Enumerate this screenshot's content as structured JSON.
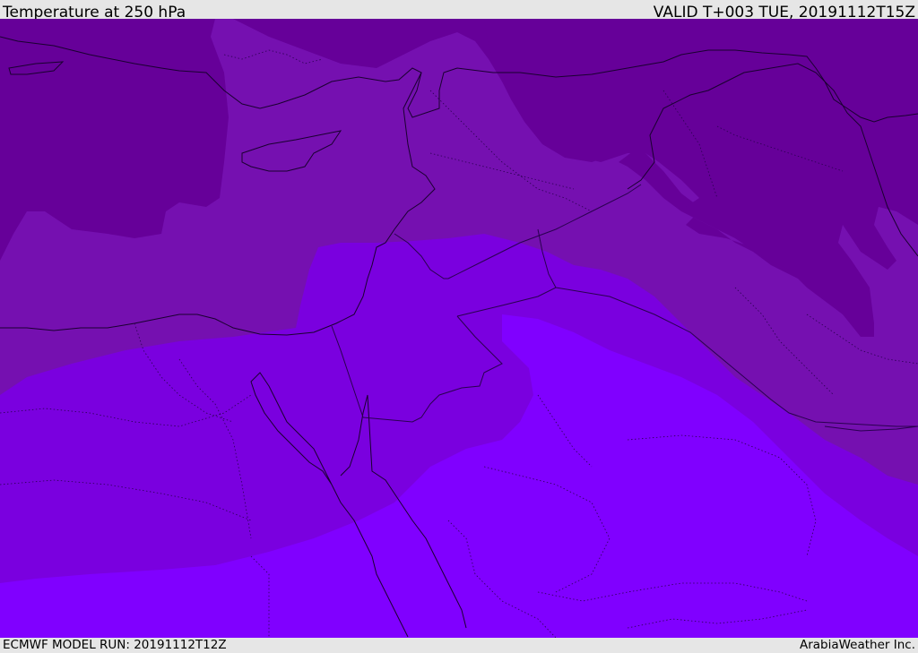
{
  "header": {
    "title": "Temperature at 250 hPa",
    "valid_time": "VALID T+003 TUE, 20191112T15Z"
  },
  "footer": {
    "model_run": "ECMWF MODEL RUN: 20191112T12Z",
    "credit": "ArabiaWeather Inc."
  },
  "map": {
    "field": "temperature",
    "level": "250 hPa",
    "region": "Eastern Mediterranean and Middle East",
    "temperature_bands": [
      {
        "band": "coldest",
        "color": "#660099"
      },
      {
        "band": "cold",
        "color": "#7510B0"
      },
      {
        "band": "mid",
        "color": "#7A00DF"
      },
      {
        "band": "warm",
        "color": "#8000FF"
      }
    ],
    "coastline_color": "#1a0030",
    "border_color": "#2a0050"
  }
}
